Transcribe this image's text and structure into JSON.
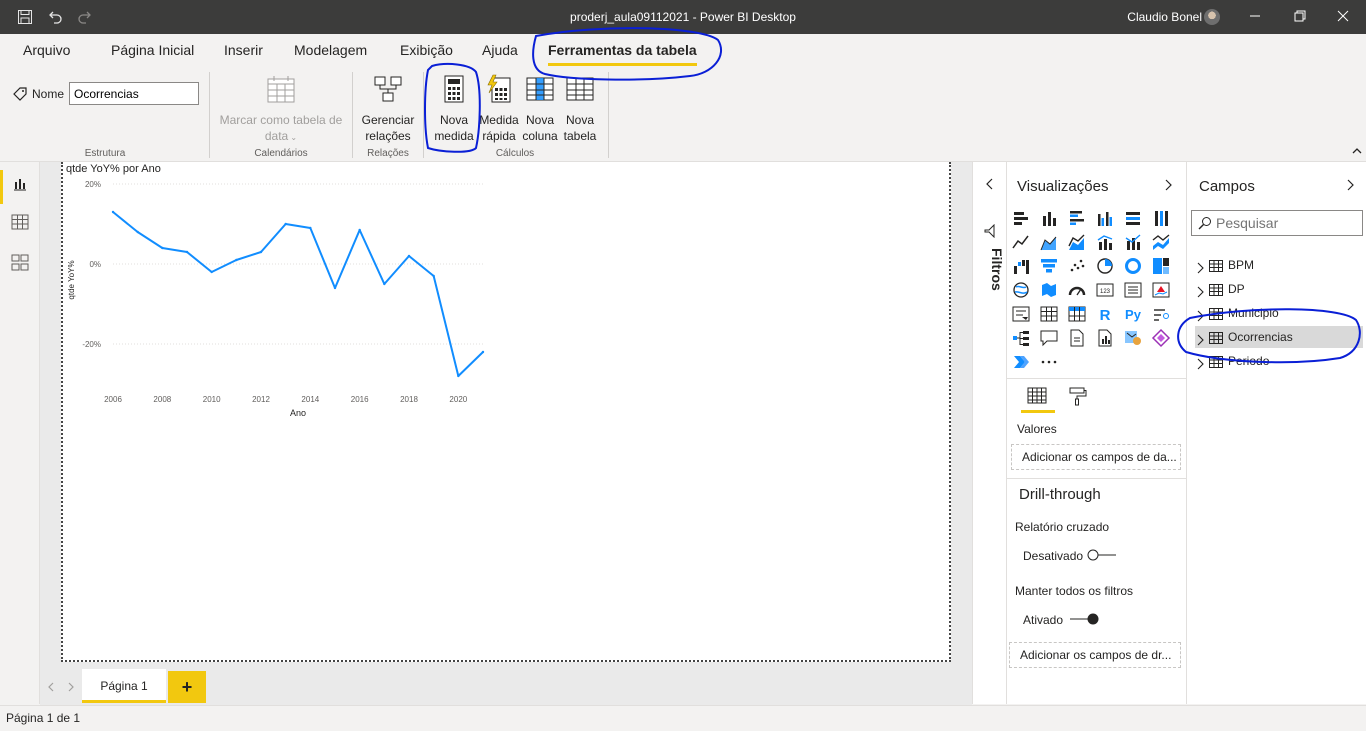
{
  "app": {
    "title": "proderj_aula09112021 - Power BI Desktop",
    "user": "Claudio Bonel"
  },
  "ribbon_tabs": [
    "Arquivo",
    "Página Inicial",
    "Inserir",
    "Modelagem",
    "Exibição",
    "Ajuda",
    "Ferramentas da tabela"
  ],
  "ribbon": {
    "name_label": "Nome",
    "name_value": "Ocorrencias",
    "estrutura": "Estrutura",
    "marcar_line1": "Marcar como tabela de",
    "marcar_line2": "data",
    "calendarios": "Calendários",
    "gerenciar_line1": "Gerenciar",
    "gerenciar_line2": "relações",
    "relacoes": "Relações",
    "nova_medida_line1": "Nova",
    "nova_medida_line2": "medida",
    "medida_rapida_line1": "Medida",
    "medida_rapida_line2": "rápida",
    "nova_coluna_line1": "Nova",
    "nova_coluna_line2": "coluna",
    "nova_tabela_line1": "Nova",
    "nova_tabela_line2": "tabela",
    "calculos": "Cálculos"
  },
  "chart_data": {
    "type": "line",
    "title": "qtde YoY% por Ano",
    "xlabel": "Ano",
    "ylabel": "qtde YoY%",
    "x": [
      2006,
      2007,
      2008,
      2009,
      2010,
      2011,
      2012,
      2013,
      2014,
      2015,
      2016,
      2017,
      2018,
      2019,
      2020,
      2021
    ],
    "y": [
      13,
      8,
      4,
      3,
      -2,
      1,
      3,
      10,
      9,
      -6,
      8.5,
      -5,
      2,
      -3,
      -28,
      -22
    ],
    "xticks": [
      "2006",
      "2008",
      "2010",
      "2012",
      "2014",
      "2016",
      "2018",
      "2020"
    ],
    "yticks": [
      "20%",
      "0%",
      "-20%"
    ],
    "ylim": [
      -28,
      20
    ],
    "grid": true,
    "color": "#118dff"
  },
  "pages": {
    "tab": "Página 1",
    "add": "+",
    "status": "Página 1 de 1"
  },
  "filters": {
    "label": "Filtros"
  },
  "visualizations": {
    "title": "Visualizações",
    "valores": "Valores",
    "add_fields": "Adicionar os campos de da...",
    "drillthrough": "Drill-through",
    "relatorio_cruzado": "Relatório cruzado",
    "desativado": "Desativado",
    "manter_filtros": "Manter todos os filtros",
    "ativado": "Ativado",
    "add_fields_dr": "Adicionar os campos de dr...",
    "more": "···"
  },
  "fields": {
    "title": "Campos",
    "search_placeholder": "Pesquisar",
    "tables": [
      "BPM",
      "DP",
      "Municipio",
      "Ocorrencias",
      "Periodo"
    ]
  },
  "colors": {
    "accent": "#f2c80f",
    "title_bar": "#3c3c3b",
    "annotation": "#0a1fd6"
  }
}
